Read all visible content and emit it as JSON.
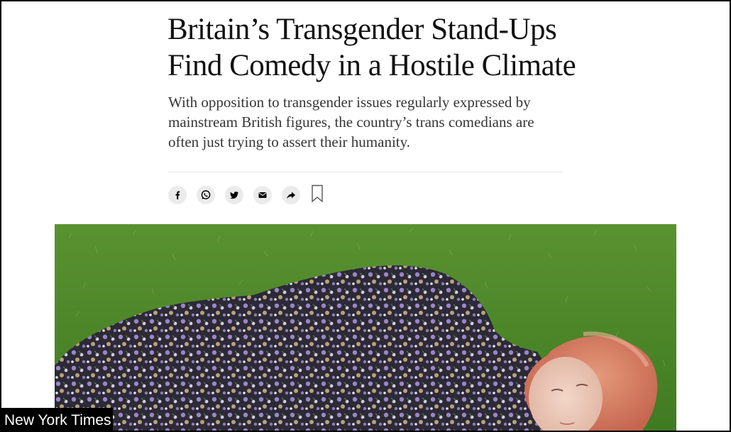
{
  "article": {
    "headline_line1": "Britain’s Transgender Stand-Ups",
    "headline_line2": "Find Comedy in a Hostile Climate",
    "summary": "With opposition to transgender issues regularly expressed by mainstream British figures, the country’s trans comedians are often just trying to assert their humanity."
  },
  "share_bar": {
    "buttons": [
      {
        "icon": "facebook-icon"
      },
      {
        "icon": "whatsapp-icon"
      },
      {
        "icon": "twitter-icon"
      },
      {
        "icon": "email-icon"
      },
      {
        "icon": "share-arrow-icon"
      },
      {
        "icon": "bookmark-icon"
      }
    ]
  },
  "caption_overlay": {
    "source": "New York Times"
  },
  "colors": {
    "text": "#121212",
    "summary": "#363636",
    "button_bg": "#ebebeb",
    "grass": "#4f8a2a",
    "hair": "#d9826a",
    "overlay_bg": "#000000"
  }
}
